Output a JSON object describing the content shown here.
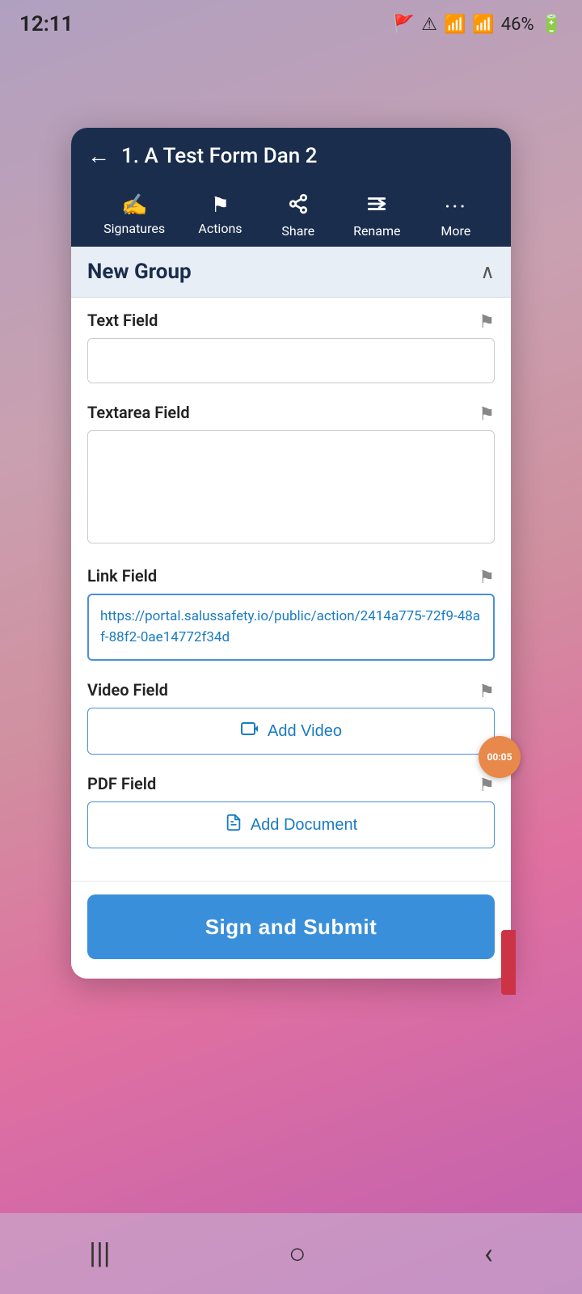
{
  "statusBar": {
    "time": "12:11",
    "batteryPercent": "46%"
  },
  "header": {
    "title": "1. A Test Form Dan 2",
    "backLabel": "←"
  },
  "toolbar": {
    "items": [
      {
        "id": "signatures",
        "icon": "✍",
        "label": "Signatures"
      },
      {
        "id": "actions",
        "icon": "⚑",
        "label": "Actions"
      },
      {
        "id": "share",
        "icon": "↗",
        "label": "Share"
      },
      {
        "id": "rename",
        "icon": "⇌",
        "label": "Rename"
      },
      {
        "id": "more",
        "icon": "···",
        "label": "More"
      }
    ]
  },
  "groupSection": {
    "title": "New Group",
    "collapseIcon": "∧"
  },
  "fields": [
    {
      "id": "text-field",
      "label": "Text Field",
      "type": "text",
      "value": "",
      "placeholder": ""
    },
    {
      "id": "textarea-field",
      "label": "Textarea Field",
      "type": "textarea",
      "value": "",
      "placeholder": ""
    },
    {
      "id": "link-field",
      "label": "Link Field",
      "type": "link",
      "value": "https://portal.salussafety.io/public/action/2414a775-72f9-48af-88f2-0ae14772f34d"
    },
    {
      "id": "video-field",
      "label": "Video Field",
      "type": "button",
      "buttonLabel": "Add Video",
      "buttonIcon": "▶"
    },
    {
      "id": "pdf-field",
      "label": "PDF Field",
      "type": "button",
      "buttonLabel": "Add Document",
      "buttonIcon": "📄"
    }
  ],
  "submitButton": {
    "label": "Sign and Submit"
  },
  "floatingBtn": {
    "label": "00:05"
  },
  "bottomNav": {
    "icons": [
      "|||",
      "○",
      "<"
    ]
  }
}
